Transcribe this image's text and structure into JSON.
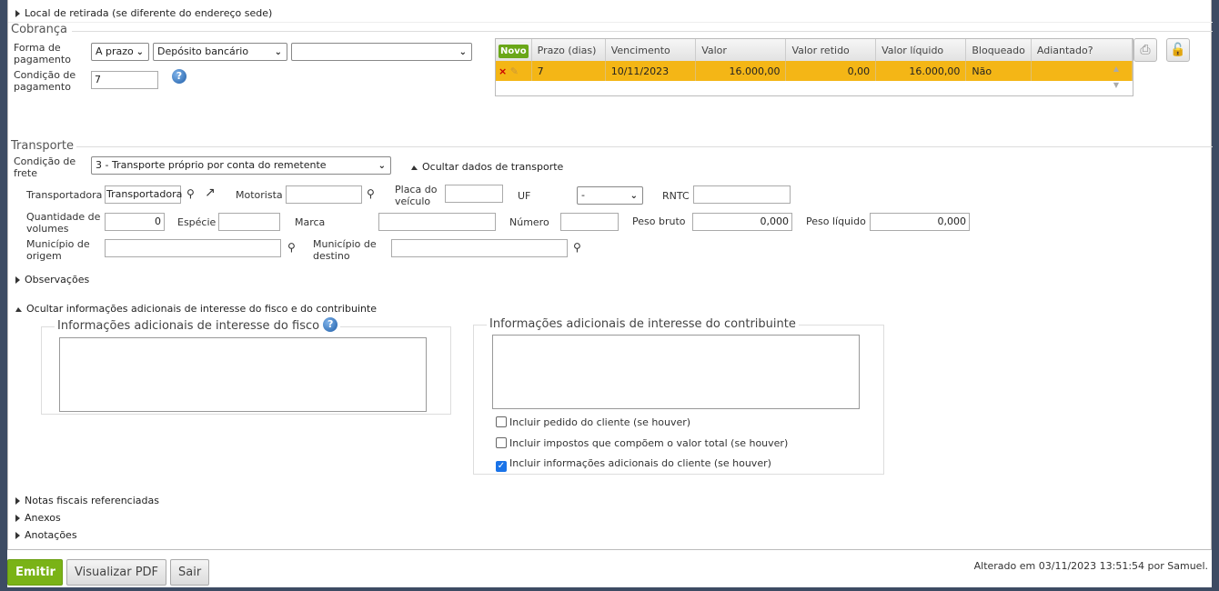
{
  "sections": {
    "local_retirada": "Local de retirada (se diferente do endereço sede)",
    "cobranca": "Cobrança",
    "transporte": "Transporte",
    "observacoes": "Observações",
    "ocultar_info": "Ocultar informações adicionais de interesse do fisco e do contribuinte",
    "notas": "Notas fiscais referenciadas",
    "anexos": "Anexos",
    "anotacoes": "Anotações"
  },
  "cobranca": {
    "forma_label": "Forma de pagamento",
    "forma_value": "A prazo",
    "meio_value": "Depósito bancário",
    "extra_value": "",
    "condicao_label": "Condição de pagamento",
    "condicao_value": "7"
  },
  "grid": {
    "novo": "Novo",
    "headers": [
      "Prazo (dias)",
      "Vencimento",
      "Valor",
      "Valor retido",
      "Valor líquido",
      "Bloqueado",
      "Adiantado?"
    ],
    "rows": [
      {
        "prazo": "7",
        "vencimento": "10/11/2023",
        "valor": "16.000,00",
        "retido": "0,00",
        "liquido": "16.000,00",
        "bloqueado": "Não",
        "adiantado": ""
      }
    ]
  },
  "transporte": {
    "frete_label": "Condição de frete",
    "frete_value": "3 - Transporte próprio por conta do remetente",
    "ocultar": "Ocultar dados de transporte",
    "transportadora_label": "Transportadora",
    "transportadora_value": "Transportadora",
    "motorista_label": "Motorista",
    "motorista_value": "",
    "placa_label": "Placa do veículo",
    "placa_value": "",
    "uf_label": "UF",
    "uf_value": "-",
    "rntc_label": "RNTC",
    "rntc_value": "",
    "qtd_label": "Quantidade de volumes",
    "qtd_value": "0",
    "especie_label": "Espécie",
    "especie_value": "",
    "marca_label": "Marca",
    "marca_value": "",
    "numero_label": "Número",
    "numero_value": "",
    "peso_bruto_label": "Peso bruto",
    "peso_bruto_value": "0,000",
    "peso_liquido_label": "Peso líquido",
    "peso_liquido_value": "0,000",
    "origem_label": "Município de origem",
    "origem_value": "",
    "destino_label": "Município de destino",
    "destino_value": ""
  },
  "info": {
    "fisco_title": "Informações adicionais de interesse do fisco",
    "contrib_title": "Informações adicionais de interesse do contribuinte",
    "cb1": "Incluir pedido do cliente (se houver)",
    "cb1_checked": false,
    "cb2": "Incluir impostos que compõem o valor total (se houver)",
    "cb2_checked": false,
    "cb3": "Incluir informações adicionais do cliente (se houver)",
    "cb3_checked": true
  },
  "footer": {
    "emitir": "Emitir",
    "pdf": "Visualizar PDF",
    "sair": "Sair",
    "status": "Alterado em 03/11/2023 13:51:54 por Samuel."
  }
}
